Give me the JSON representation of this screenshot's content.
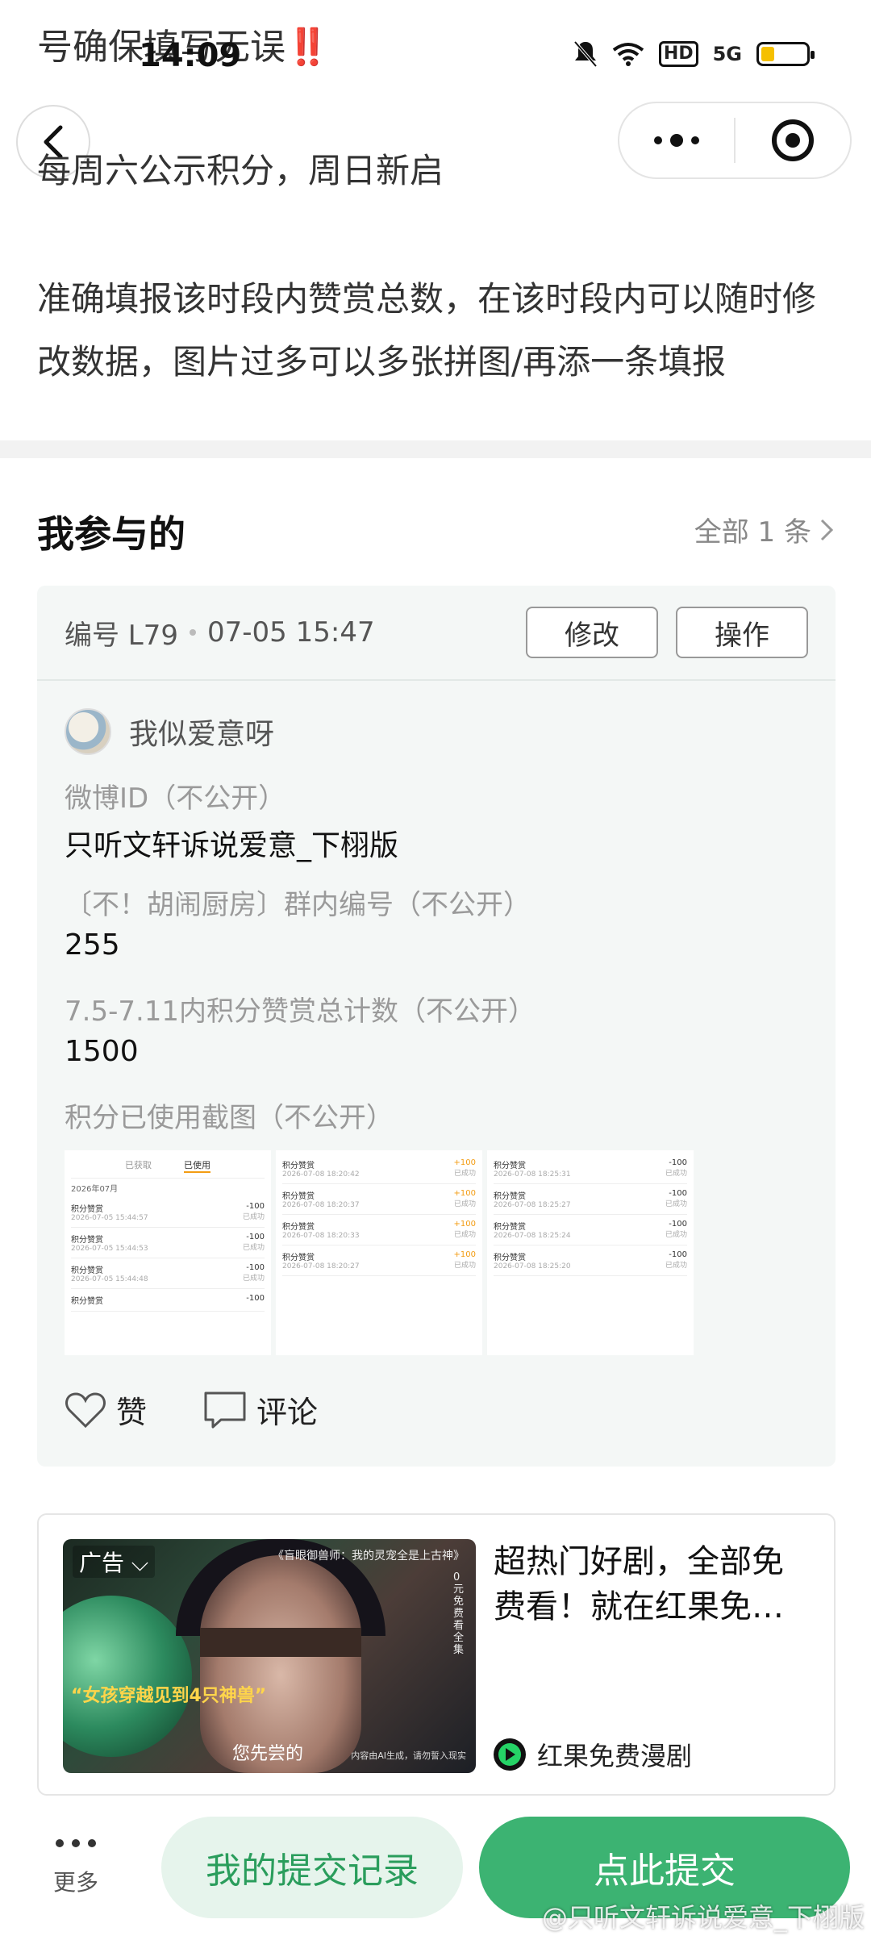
{
  "status_bar": {
    "time": "14:09",
    "network": "5G",
    "hd": "HD",
    "battery_level": 0.3
  },
  "scrolled_text": {
    "line": "号确保填写无误",
    "warning": "‼️"
  },
  "header": {
    "notice_line1": "每周六公示积分，周日新启",
    "notice_line2": "准确填报该时段内赞赏总数，在该时段内可以随时修改数据，图片过多可以多张拼图/再添一条填报"
  },
  "participation": {
    "title": "我参与的",
    "see_all": "全部 1 条",
    "entry": {
      "number": "编号 L79",
      "time": "07-05 15:47",
      "edit_label": "修改",
      "operate_label": "操作",
      "user_name": "我似爱意呀",
      "fields": [
        {
          "label": "微博ID（不公开）",
          "value": "只听文轩诉说爱意_下栩版"
        },
        {
          "label": "〔不！胡闹厨房〕群内编号（不公开）",
          "value": "255"
        },
        {
          "label": "7.5-7.11内积分赞赏总计数（不公开）",
          "value": "1500"
        }
      ],
      "screenshot_label": "积分已使用截图（不公开）",
      "screenshots": {
        "tab_obtained": "已获取",
        "tab_used": "已使用",
        "month": "2026年07月",
        "panel1": [
          {
            "title": "积分赞赏",
            "time": "2026-07-05 15:44:57",
            "amount": "-100",
            "status": "已成功"
          },
          {
            "title": "积分赞赏",
            "time": "2026-07-05 15:44:53",
            "amount": "-100",
            "status": "已成功"
          },
          {
            "title": "积分赞赏",
            "time": "2026-07-05 15:44:48",
            "amount": "-100",
            "status": "已成功"
          },
          {
            "title": "积分赞赏",
            "time": "",
            "amount": "-100",
            "status": ""
          }
        ],
        "panel2": [
          {
            "title": "积分赞赏",
            "time": "2026-07-08 18:20:42",
            "amount": "+100",
            "status": "已成功"
          },
          {
            "title": "积分赞赏",
            "time": "2026-07-08 18:20:37",
            "amount": "+100",
            "status": "已成功"
          },
          {
            "title": "积分赞赏",
            "time": "2026-07-08 18:20:33",
            "amount": "+100",
            "status": "已成功"
          },
          {
            "title": "积分赞赏",
            "time": "2026-07-08 18:20:27",
            "amount": "+100",
            "status": "已成功"
          }
        ],
        "panel3": [
          {
            "title": "积分赞赏",
            "time": "2026-07-08 18:25:31",
            "amount": "-100",
            "status": "已成功"
          },
          {
            "title": "积分赞赏",
            "time": "2026-07-08 18:25:27",
            "amount": "-100",
            "status": "已成功"
          },
          {
            "title": "积分赞赏",
            "time": "2026-07-08 18:25:24",
            "amount": "-100",
            "status": "已成功"
          },
          {
            "title": "积分赞赏",
            "time": "2026-07-08 18:25:20",
            "amount": "-100",
            "status": "已成功"
          }
        ]
      },
      "like_label": "赞",
      "comment_label": "评论"
    }
  },
  "ad": {
    "tag": "广告",
    "caption_top": "《盲眼御兽师：我的灵宠全是上古神》",
    "caption_side": "0元免费看全集",
    "caption_quote": "“女孩穿越见到4只神兽”",
    "caption_sub": "您先尝的",
    "caption_small": "内容由AI生成，请勿誓入现实",
    "title": "超热门好剧，全部免费看！就在红果免…",
    "brand": "红果免费漫剧"
  },
  "bottom_bar": {
    "more_label": "更多",
    "records_label": "我的提交记录",
    "submit_label": "点此提交"
  },
  "watermark": "@只听文轩诉说爱意_下栩版",
  "colors": {
    "accent": "#3cb372",
    "accent_light": "#e6f4ec",
    "card_bg": "#f4f7f6",
    "warning": "#e0262b"
  }
}
